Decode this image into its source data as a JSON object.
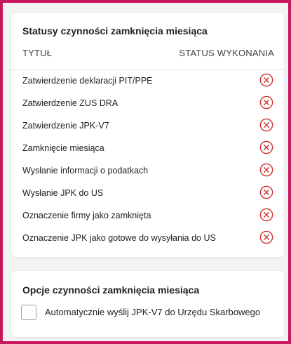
{
  "status_card": {
    "title": "Statusy czynności zamknięcia miesiąca",
    "columns": {
      "title": "TYTUŁ",
      "status": "STATUS WYKONANIA"
    },
    "rows": [
      {
        "label": "Zatwierdzenie deklaracji PIT/PPE",
        "status": "error-circle-icon"
      },
      {
        "label": "Zatwierdzenie ZUS DRA",
        "status": "error-circle-icon"
      },
      {
        "label": "Zatwierdzenie JPK-V7",
        "status": "error-circle-icon"
      },
      {
        "label": "Zamknięcie miesiąca",
        "status": "error-circle-icon"
      },
      {
        "label": "Wysłanie informacji o podatkach",
        "status": "error-circle-icon"
      },
      {
        "label": "Wysłanie JPK do US",
        "status": "error-circle-icon"
      },
      {
        "label": "Oznaczenie firmy jako zamknięta",
        "status": "error-circle-icon"
      },
      {
        "label": "Oznaczenie JPK jako gotowe do wysyłania do US",
        "status": "error-circle-icon"
      }
    ]
  },
  "options_card": {
    "title": "Opcje czynności zamknięcia miesiąca",
    "checkbox_label": "Automatycznie wyślij JPK-V7 do Urzędu Skarbowego",
    "checked": false
  },
  "colors": {
    "frame_border": "#c8185c",
    "status_error": "#d32f2f"
  }
}
